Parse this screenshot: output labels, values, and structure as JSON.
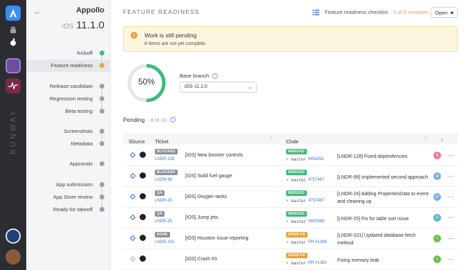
{
  "rail": {
    "brand": "RUNWAY",
    "icons": [
      "runway-logo-icon",
      "android-icon",
      "apple-icon",
      "app-icon-purple",
      "app-icon-pulse"
    ],
    "avatars": [
      "org-avatar",
      "user-avatar"
    ]
  },
  "sidebar": {
    "app_name": "Appollo",
    "os": "iOS",
    "version": "11.1.0",
    "steps": [
      {
        "label": "Kickoff",
        "status": "done",
        "color": "#3dbb7a"
      },
      {
        "label": "Feature readiness",
        "status": "active",
        "color": "#e9a23b"
      },
      {
        "label": "Release candidate",
        "status": "pending",
        "color": "#8a8f97"
      },
      {
        "label": "Regression testing",
        "status": "pending",
        "color": "#8a8f97"
      },
      {
        "label": "Beta testing",
        "status": "pending",
        "color": "#8a8f97"
      },
      {
        "label": "Screenshots",
        "status": "pending",
        "color": "#8a8f97"
      },
      {
        "label": "Metadata",
        "status": "pending",
        "color": "#8a8f97"
      },
      {
        "label": "Approvals",
        "status": "pending",
        "color": "#8a8f97"
      },
      {
        "label": "App submission",
        "status": "pending",
        "color": "#8a8f97"
      },
      {
        "label": "App Store review",
        "status": "pending",
        "color": "#8a8f97"
      },
      {
        "label": "Ready for takeoff",
        "status": "pending",
        "color": "#8a8f97"
      }
    ]
  },
  "header": {
    "title": "FEATURE READINESS",
    "checklist_label": "Feature readiness checklist",
    "checklist_count": "- 5 of 9 complete",
    "open_button": "Open"
  },
  "alert": {
    "title": "Work is still pending",
    "message": "8 items are not yet complete."
  },
  "progress": {
    "percent_label": "50%",
    "value": 0.5,
    "color": "#3dbb7a"
  },
  "base_branch": {
    "label": "Base branch",
    "value": "iOS-11.1.0"
  },
  "pending": {
    "title": "Pending",
    "count": "- 8 of 16"
  },
  "table": {
    "columns": {
      "source": "Source",
      "ticket": "Ticket",
      "code": "Code"
    },
    "rows": [
      {
        "status": "BLOCKED",
        "status_class": "b-blocked",
        "ticket_id": "LNDR-128",
        "ticket_title": "[iOS] New booster controls",
        "code_status": "MERGED",
        "code_class": "b-merged",
        "branch": "master",
        "ref": "845a93c",
        "code_title": "[LNDR-128] Fixed dependencies",
        "avatar": "S",
        "avatar_color": "#e57aa0"
      },
      {
        "status": "BLOCKED",
        "status_class": "b-blocked",
        "ticket_id": "LNDR-99",
        "ticket_title": "[iOS] Solid fuel gauge",
        "code_status": "MERGED",
        "code_class": "b-merged",
        "branch": "master",
        "ref": "4757487",
        "code_title": "[LNDR-99] Implemented second approach",
        "avatar": "G",
        "avatar_color": "#7ab0e0"
      },
      {
        "status": "QA",
        "status_class": "b-qa",
        "ticket_id": "LNDR-24",
        "ticket_title": "[iOS] Oxygen tanks",
        "code_status": "MERGED",
        "code_class": "b-merged",
        "branch": "master",
        "ref": "4757487",
        "code_title": "[LNDR-24] Adding PropertiesData to event and cleaning up",
        "avatar": "G",
        "avatar_color": "#7ab0e0"
      },
      {
        "status": "QA",
        "status_class": "b-qa",
        "ticket_id": "LNDR-25",
        "ticket_title": "[iOS] Jump jets",
        "code_status": "MERGED",
        "code_class": "b-merged",
        "branch": "master",
        "ref": "0662958",
        "code_title": "[LNDR-25] Fix for table sort issue",
        "avatar": "D",
        "avatar_color": "#5ab8c8"
      },
      {
        "status": "DONE",
        "status_class": "b-done",
        "ticket_id": "LNDR-101",
        "ticket_title": "[iOS] Houston issue reporting",
        "code_status": "OPEN PR",
        "code_class": "b-openpr",
        "branch": "master",
        "ref": "PR #1388",
        "code_title": "[LNDR-101] Updated database fetch method",
        "avatar": "I",
        "avatar_color": "#6cc04a"
      },
      {
        "status": "",
        "status_class": "",
        "ticket_id": "",
        "ticket_title": "[iOS] Crash #3",
        "code_status": "OPEN PR",
        "code_class": "b-openpr",
        "branch": "master",
        "ref": "PR #1382",
        "code_title": "Fixing memory leak",
        "avatar": "I",
        "avatar_color": "#6cc04a"
      }
    ]
  }
}
